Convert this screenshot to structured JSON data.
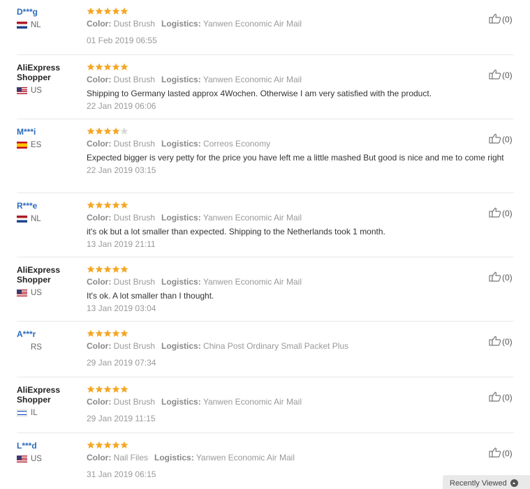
{
  "labels": {
    "color": "Color:",
    "logistics": "Logistics:"
  },
  "reviews": [
    {
      "user": "D***g",
      "masked": true,
      "country": "NL",
      "flag": "nl",
      "rating": 5,
      "color": "Dust Brush",
      "logistics": "Yanwen Economic Air Mail",
      "comment": "",
      "date": "01 Feb 2019 06:55",
      "helpful": "(0)"
    },
    {
      "user": "AliExpress Shopper",
      "masked": false,
      "country": "US",
      "flag": "us",
      "rating": 5,
      "color": "Dust Brush",
      "logistics": "Yanwen Economic Air Mail",
      "comment": "Shipping to Germany lasted approx 4Wochen. Otherwise I am very satisfied with the product.",
      "date": "22 Jan 2019 06:06",
      "helpful": "(0)"
    },
    {
      "user": "M***i",
      "masked": true,
      "country": "ES",
      "flag": "es",
      "rating": 4,
      "color": "Dust Brush",
      "logistics": "Correos Economy",
      "comment": "Expected bigger is very petty for the price you have left me a little mashed But good is nice and me to come right",
      "date": "22 Jan 2019 03:15",
      "helpful": "(0)"
    },
    {
      "user": "R***e",
      "masked": true,
      "country": "NL",
      "flag": "nl",
      "rating": 5,
      "color": "Dust Brush",
      "logistics": "Yanwen Economic Air Mail",
      "comment": "it's ok but a lot smaller than expected. Shipping to the Netherlands took 1 month.",
      "date": "13 Jan 2019 21:11",
      "helpful": "(0)"
    },
    {
      "user": "AliExpress Shopper",
      "masked": false,
      "country": "US",
      "flag": "us",
      "rating": 5,
      "color": "Dust Brush",
      "logistics": "Yanwen Economic Air Mail",
      "comment": "It's ok. A lot smaller than I thought.",
      "date": "13 Jan 2019 03:04",
      "helpful": "(0)"
    },
    {
      "user": "A***r",
      "masked": true,
      "country": "RS",
      "flag": "empty",
      "rating": 5,
      "color": "Dust Brush",
      "logistics": "China Post Ordinary Small Packet Plus",
      "comment": "",
      "date": "29 Jan 2019 07:34",
      "helpful": "(0)"
    },
    {
      "user": "AliExpress Shopper",
      "masked": false,
      "country": "IL",
      "flag": "il",
      "rating": 5,
      "color": "Dust Brush",
      "logistics": "Yanwen Economic Air Mail",
      "comment": "",
      "date": "29 Jan 2019 11:15",
      "helpful": "(0)"
    },
    {
      "user": "L***d",
      "masked": true,
      "country": "US",
      "flag": "us",
      "rating": 5,
      "color": "Nail Files",
      "logistics": "Yanwen Economic Air Mail",
      "comment": "",
      "date": "31 Jan 2019 06:15",
      "helpful": "(0)"
    }
  ],
  "recently_viewed": {
    "label": "Recently Viewed",
    "icon": "chevron-up-icon"
  },
  "icons": {
    "helpful": "thumbs-up-icon",
    "star": "star-icon"
  },
  "colors": {
    "star": "#f6a623",
    "star_empty": "#d8d8d8",
    "link": "#2c6bbd"
  }
}
